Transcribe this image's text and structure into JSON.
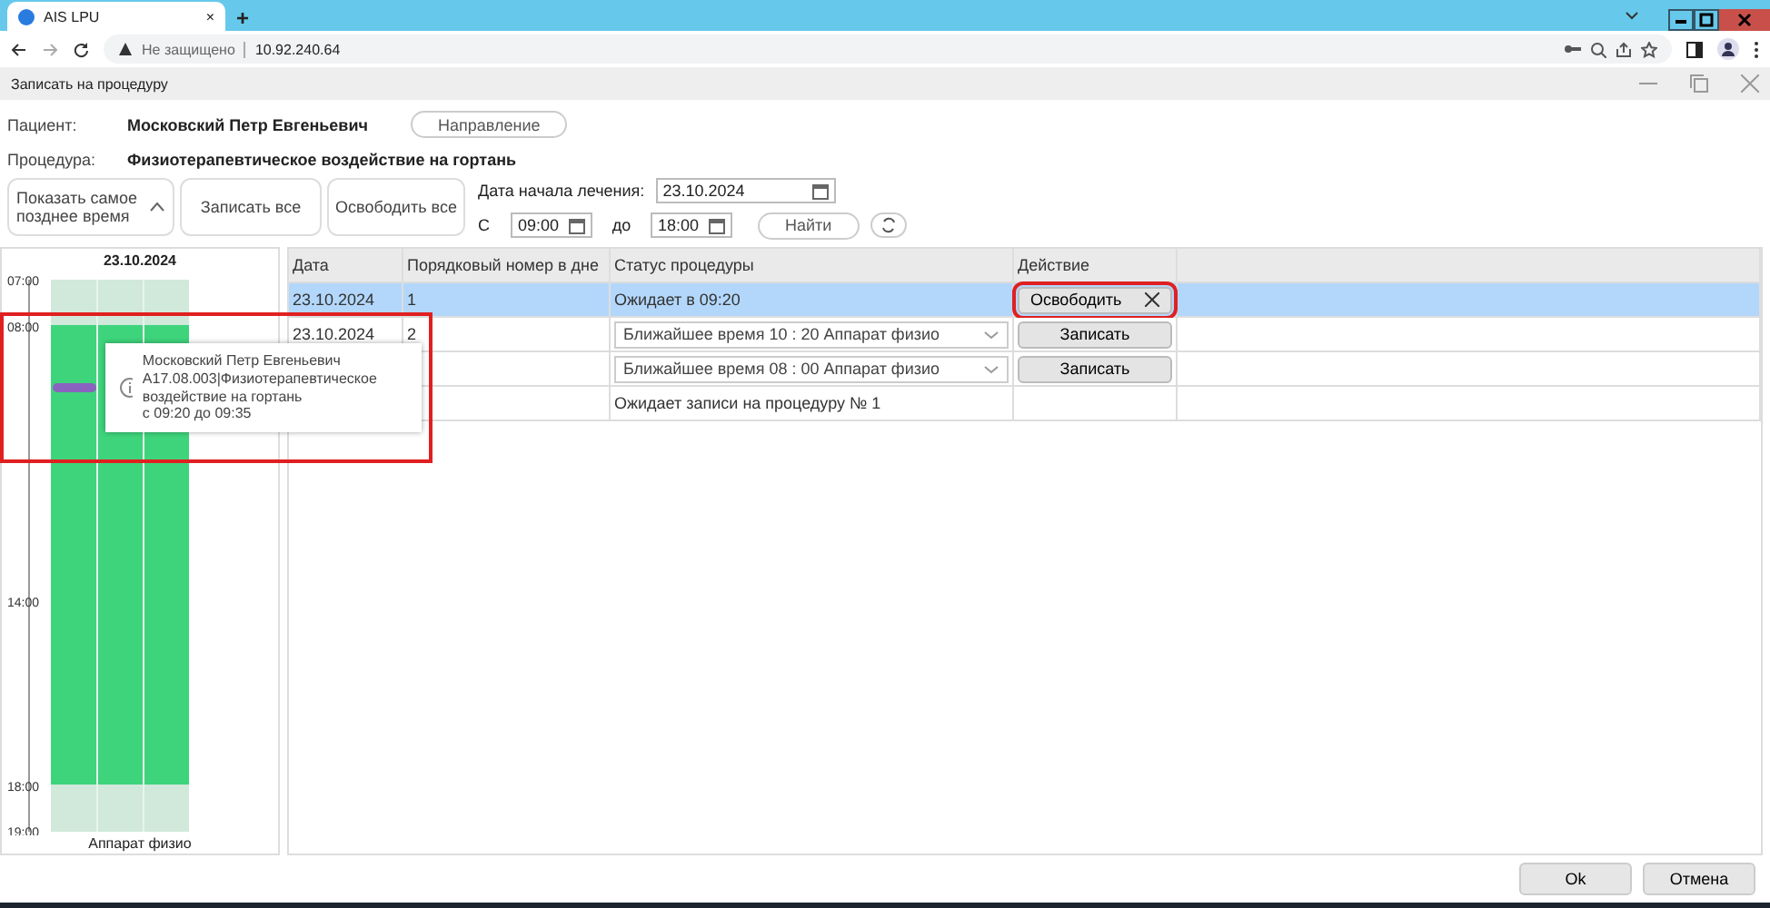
{
  "browser": {
    "tab_title": "AIS LPU",
    "tab_close": "×",
    "new_tab": "+",
    "security": "Не защищено",
    "url": "10.92.240.64"
  },
  "dialog": {
    "title": "Записать на процедуру"
  },
  "patient": {
    "label": "Пациент:",
    "value": "Московский Петр Евгеньевич",
    "button": "Направление"
  },
  "procedure": {
    "label": "Процедура:",
    "value": "Физиотерапевтическое воздействие на гортань"
  },
  "toolbar": {
    "show_latest": {
      "label": "Показать самое позднее время",
      "expanded": true
    },
    "book_all": "Записать все",
    "release_all": "Освободить все",
    "start_date_label": "Дата начала лечения:",
    "start_date": "23.10.2024",
    "from_label": "С",
    "from": "09:00",
    "to_label": "до",
    "to": "18:00",
    "find": "Найти"
  },
  "schedule": {
    "date": "23.10.2024",
    "times": [
      "07:00",
      "08:00",
      "14:00",
      "18:00",
      "19:00"
    ],
    "resource": "Аппарат физио"
  },
  "tooltip": {
    "highlighted": true,
    "lines": [
      "Московский Петр Евгеньевич",
      "A17.08.003|Физиотерапевтическое воздействие на гортань",
      "с 09:20 до 09:35"
    ]
  },
  "table": {
    "columns": [
      "Дата",
      "Порядковый номер в дне",
      "Статус процедуры",
      "Действие"
    ],
    "rows": [
      {
        "selected": true,
        "date": "23.10.2024",
        "number": "1",
        "status": {
          "kind": "text",
          "text": "Ожидает в 09:20"
        },
        "action": {
          "kind": "release",
          "label": "Освободить",
          "highlighted": true
        }
      },
      {
        "selected": false,
        "date": "23.10.2024",
        "number": "2",
        "status": {
          "kind": "select",
          "text": "Ближайшее время 10 : 20 Аппарат физио"
        },
        "action": {
          "kind": "book",
          "label": "Записать",
          "highlighted": false
        }
      },
      {
        "selected": false,
        "status": {
          "kind": "select",
          "text": "Ближайшее время 08 : 00 Аппарат физио"
        },
        "action": {
          "kind": "book",
          "label": "Записать",
          "highlighted": false
        }
      },
      {
        "selected": false,
        "status": {
          "kind": "text",
          "text": "Ожидает записи на процедуру № 1"
        }
      }
    ]
  },
  "footer": {
    "ok": "Ok",
    "cancel": "Отмена"
  }
}
